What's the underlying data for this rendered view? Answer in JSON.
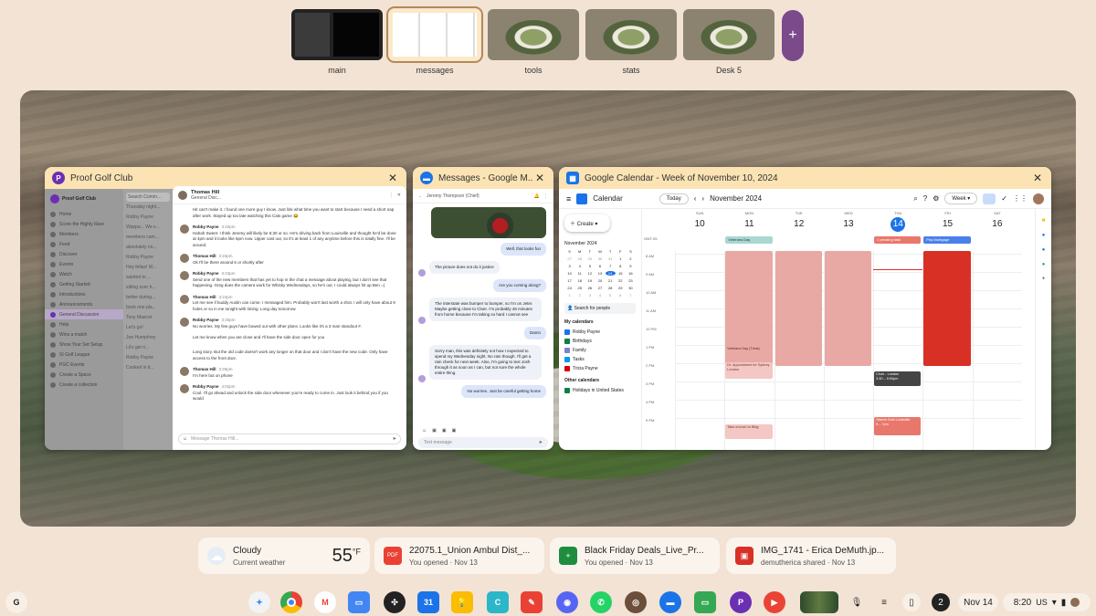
{
  "desks": [
    {
      "label": "main"
    },
    {
      "label": "messages"
    },
    {
      "label": "tools"
    },
    {
      "label": "stats"
    },
    {
      "label": "Desk 5"
    }
  ],
  "add_desk": "+",
  "windows": {
    "proof": {
      "title": "Proof Golf Club",
      "logo": "P",
      "sidebar_title": "Proof Golf Club",
      "search": "Search Comm...",
      "sidebar": [
        "Home",
        "Score the Highly Rare",
        "Members",
        "Feed",
        "Discover",
        "Events",
        "Watch",
        "Getting Started",
        "Introductions",
        "Announcements",
        "General Discussion",
        "Help",
        "Wins a match",
        "Show Your Set Setup",
        "SI Golf League",
        "PGC Events",
        "Create a Space",
        "Create a collection"
      ],
      "thread": {
        "author": "Thomas Hill",
        "subtitle": "General Disc...",
        "messages": [
          {
            "name": "",
            "time": "",
            "text": "Hit can't make it. I found one more guy I know. Just link what time you want to start because I need a short nap after work. Stayed up too late watching this Cats game 😂"
          },
          {
            "name": "Robby Payne",
            "time": "3:20pm",
            "text": "Hahah Sweet. I think Jeremy will likely be 6:30 or so. He's driving back from Louisville and thought he'd be done at 4pm and it looks like 6pm now. Upper cast out, so it's at least 1 of any anytime before this is totally fine. I'll be around."
          },
          {
            "name": "Thomas Hill",
            "time": "3:23pm",
            "text": "Ok I'll be there around 6 or shortly after"
          },
          {
            "name": "Robby Payne",
            "time": "3:23pm",
            "text": "Send one of the new members that has yet to hop in the chat a message about playing, but I don't see that happening. Greg does the camera work for Whisky Wednesdays, so he's out. I could always hit up Ben =)"
          },
          {
            "name": "Thomas Hill",
            "time": "3:24pm",
            "text": "Let me see if buddy Austin can come. I messaged him. Probably won't last worth a shot. I will only have about 9 holes or so in me tonight with timing. Long day tomorrow."
          },
          {
            "name": "Robby Payne",
            "time": "3:25pm",
            "text": "No worries. My few guys have bowed out with other plans. Looks like it's a 3 man standout #."
          },
          {
            "name": "",
            "time": "",
            "text": "Let me know when you are close and I'll have the side door open for you"
          },
          {
            "name": "",
            "time": "",
            "text": "Long story. But the old code doesn't work any longer on that door and I don't have the new code. Only have access to the front door."
          },
          {
            "name": "Thomas Hill",
            "time": "3:26pm",
            "text": "I'm here but on phone"
          },
          {
            "name": "Robby Payne",
            "time": "4:02pm",
            "text": "Cool. I'll go ahead and unlock the side door whenever you're ready to come in. Just look it behind you if you would"
          }
        ],
        "input": "Message Thomas Hill..."
      },
      "left_snippets": [
        "Thursday night...",
        "Robby Payne",
        "Wappa... We s...",
        "members cam...",
        "absolutely no...",
        "Robby Payne",
        "Hey fellas! W...",
        "wanted to ...",
        "sitting over h...",
        "better during...",
        "book one pla...",
        "Tony Mascot",
        "Let's go!",
        "Joe Humphrey",
        "Lil's get ri...",
        "Robby Payne",
        "Cooked in it..."
      ]
    },
    "messages": {
      "title": "Messages - Google M...",
      "contact": "Jeremy Thompson (Chief)",
      "bubbles": [
        {
          "dir": "in",
          "text": ""
        },
        {
          "dir": "out",
          "text": "Well, that looks fun"
        },
        {
          "dir": "in",
          "text": "The picture does not do it justice"
        },
        {
          "dir": "out",
          "text": "Are you coming along?"
        },
        {
          "dir": "in",
          "text": "The interstate was bumper to bumper, so I'm on Jeter. Maybe getting close to Cloer. I'm probably 45 minutes from home because I'm taking so hard I cannot see"
        },
        {
          "dir": "out",
          "text": "Damn"
        },
        {
          "dir": "in",
          "text": "Sorry man, this was definitely not how I expected to spend my Wednesday night. No rain though. I'll get a rain check for next week. Also, I'm going to text Josh through it as soon as I can, but not sure the whole entire thing."
        },
        {
          "dir": "out",
          "text": "No worries. Just be careful getting home"
        }
      ],
      "input": "Text message"
    },
    "calendar": {
      "title": "Google Calendar - Week of November 10, 2024",
      "app": "Calendar",
      "today": "Today",
      "month": "November 2024",
      "view": "Week",
      "create": "Create",
      "mini_month": "November 2024",
      "mini_days": [
        "S",
        "M",
        "T",
        "W",
        "T",
        "F",
        "S"
      ],
      "mini_dates": [
        "27",
        "28",
        "29",
        "30",
        "31",
        "1",
        "2",
        "3",
        "4",
        "5",
        "6",
        "7",
        "8",
        "9",
        "10",
        "11",
        "12",
        "13",
        "14",
        "15",
        "16",
        "17",
        "18",
        "19",
        "20",
        "21",
        "22",
        "23",
        "24",
        "25",
        "26",
        "27",
        "28",
        "29",
        "30",
        "1",
        "2",
        "3",
        "4",
        "5",
        "6",
        "7"
      ],
      "search_people": "Search for people",
      "my_calendars_label": "My calendars",
      "my_calendars": [
        {
          "name": "Robby Payne",
          "color": "#1a73e8"
        },
        {
          "name": "Birthdays",
          "color": "#0b8043"
        },
        {
          "name": "Family",
          "color": "#7986cb"
        },
        {
          "name": "Tasks",
          "color": "#039be5"
        },
        {
          "name": "Tricia Payne",
          "color": "#d50000"
        }
      ],
      "other_calendars_label": "Other calendars",
      "other_calendars": [
        {
          "name": "Holidays in United States",
          "color": "#0b8043"
        }
      ],
      "days": [
        {
          "dow": "SUN",
          "num": "10"
        },
        {
          "dow": "MON",
          "num": "11"
        },
        {
          "dow": "TUE",
          "num": "12"
        },
        {
          "dow": "WED",
          "num": "13"
        },
        {
          "dow": "THU",
          "num": "14"
        },
        {
          "dow": "FRI",
          "num": "15"
        },
        {
          "dow": "SAT",
          "num": "16"
        }
      ],
      "tz": "GMT-05",
      "allday": [
        {
          "day": 1,
          "text": "Veterans Day"
        },
        {
          "day": 4,
          "text": "1 pending task"
        },
        {
          "day": 5,
          "text": "Pay Mortgage"
        }
      ],
      "hours": [
        "8 AM",
        "9 AM",
        "10 AM",
        "11 AM",
        "12 PM",
        "1 PM",
        "2 PM",
        "3 PM",
        "4 PM",
        "5 PM"
      ],
      "events": [
        {
          "text": "Veterans Day (Tricia)",
          "time": ""
        },
        {
          "text": "Dr. Appointment for Sydney",
          "time": "London"
        },
        {
          "text": "Take a lunch to Bldg",
          "time": ""
        },
        {
          "text": "Choir - London",
          "time": "3:30 – 5:00pm"
        },
        {
          "text": "Sisters Club Louisville",
          "time": "5 – 7pm"
        }
      ]
    }
  },
  "shelf": [
    {
      "title": "Cloudy",
      "sub": "Current weather",
      "temp": "55",
      "unit": "°F",
      "icon": "cloud-icon"
    },
    {
      "title": "22075.1_Union Ambul Dist_...",
      "sub": "You opened · Nov 13",
      "icon": "pdf-icon",
      "color": "#e94235"
    },
    {
      "title": "Black Friday Deals_Live_Pr...",
      "sub": "You opened · Nov 13",
      "icon": "sheets-icon",
      "color": "#1e8e3e"
    },
    {
      "title": "IMG_1741 - Erica DeMuth.jp...",
      "sub": "demutherica shared · Nov 13",
      "icon": "image-icon",
      "color": "#d93025"
    }
  ],
  "taskbar": {
    "launcher": "G",
    "date": "Nov 14",
    "time": "8:20",
    "region": "US",
    "badge": "2"
  },
  "colors": {
    "window_header": "#fbe3b4",
    "accent_purple": "#6b2fb3",
    "calendar_event_red": "#d93025",
    "calendar_event_pink": "#e8a9a4",
    "today_blue": "#1a73e8"
  }
}
